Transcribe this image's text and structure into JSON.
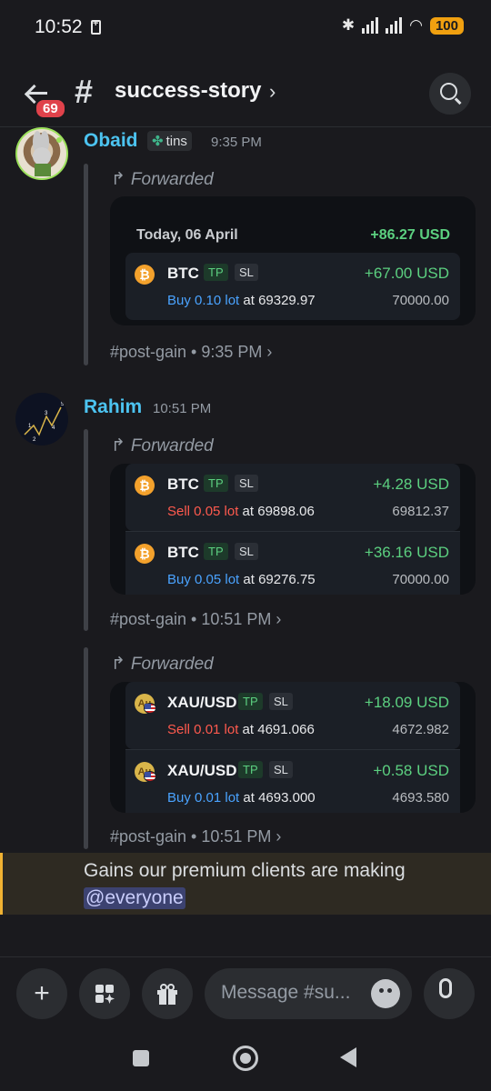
{
  "status_bar": {
    "time": "10:52",
    "battery": "100"
  },
  "header": {
    "unread_badge": "69",
    "channel_name": "success-story",
    "icons": [
      "back-arrow-icon",
      "hash-icon",
      "chevron-right-icon",
      "search-icon"
    ]
  },
  "messages": [
    {
      "author": "Obaid",
      "tag": "tins",
      "time": "9:35 PM",
      "forwarded_label": "Forwarded",
      "card": {
        "date": "Today, 06 April",
        "total": "+86.27 USD",
        "trades": [
          {
            "symbol": "BTC",
            "tp": "TP",
            "sl": "SL",
            "pnl": "+67.00 USD",
            "action": "Buy 0.10 lot",
            "at": " at 69329.97",
            "target": "70000.00",
            "side": "buy"
          }
        ]
      },
      "footer": "#post-gain • 9:35 PM  ›"
    },
    {
      "author": "Rahim",
      "time": "10:51 PM",
      "forwarded_label": "Forwarded",
      "card": {
        "trades": [
          {
            "symbol": "BTC",
            "tp": "TP",
            "sl": "SL",
            "pnl": "+4.28 USD",
            "action": "Sell 0.05 lot",
            "at": " at 69898.06",
            "target": "69812.37",
            "side": "sell"
          },
          {
            "symbol": "BTC",
            "tp": "TP",
            "sl": "SL",
            "pnl": "+36.16 USD",
            "action": "Buy 0.05 lot",
            "at": " at 69276.75",
            "target": "70000.00",
            "side": "buy"
          }
        ]
      },
      "footer": "#post-gain • 10:51 PM  ›"
    },
    {
      "forwarded_label": "Forwarded",
      "card": {
        "trades": [
          {
            "symbol": "XAU/USD",
            "tp": "TP",
            "sl": "SL",
            "pnl": "+18.09 USD",
            "action": "Sell 0.01 lot",
            "at": " at 4691.066",
            "target": "4672.982",
            "side": "sell"
          },
          {
            "symbol": "XAU/USD",
            "tp": "TP",
            "sl": "SL",
            "pnl": "+0.58 USD",
            "action": "Buy 0.01 lot",
            "at": " at 4693.000",
            "target": "4693.580",
            "side": "buy"
          }
        ]
      },
      "footer": "#post-gain • 10:51 PM  ›"
    }
  ],
  "highlight": {
    "text": "Gains our premium clients are making",
    "mention": "@everyone"
  },
  "composer": {
    "placeholder": "Message #su...",
    "plus": "+",
    "icons": [
      "plus-icon",
      "apps-icon",
      "gift-icon",
      "emoji-icon",
      "microphone-icon"
    ]
  },
  "colors": {
    "accent_name": "#4cc3f0",
    "profit_green": "#5cd080",
    "buy_blue": "#4aa3ff",
    "sell_red": "#ff5a4e",
    "mention_bg": "#3c4270",
    "highlight_bar": "#f0b232"
  }
}
